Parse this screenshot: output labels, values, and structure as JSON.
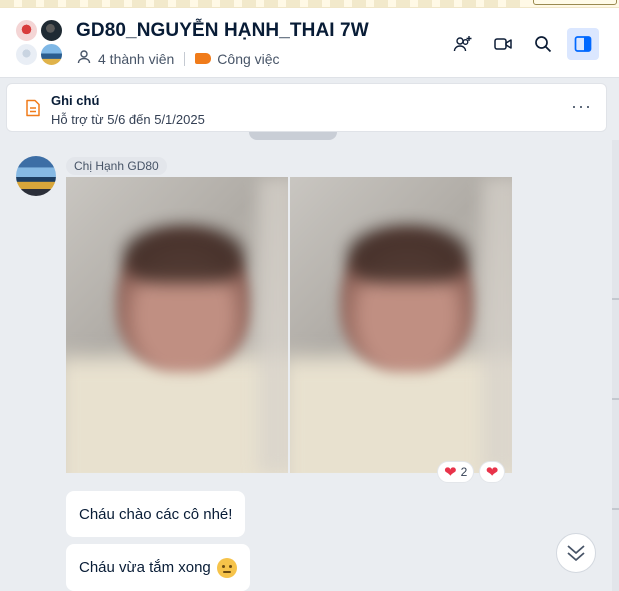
{
  "header": {
    "title": "GD80_NGUYỄN HẠNH_THAI 7W",
    "members_label": "4 thành viên",
    "category_label": "Công việc",
    "icons": [
      "add-member-icon",
      "video-call-icon",
      "search-icon",
      "sidebar-panel-icon"
    ]
  },
  "pinned": {
    "title": "Ghi chú",
    "subtitle": "Hỗ trợ từ 5/6 đến 5/1/2025",
    "more_label": "···"
  },
  "message": {
    "sender": "Chị Hạnh GD80",
    "reaction_count": "2",
    "texts": [
      "Cháu chào các cô nhé!",
      "Cháu vừa tắm xong"
    ]
  },
  "colors": {
    "accent": "#0068ff",
    "tag": "#f07b1a",
    "heart": "#e8334a"
  }
}
